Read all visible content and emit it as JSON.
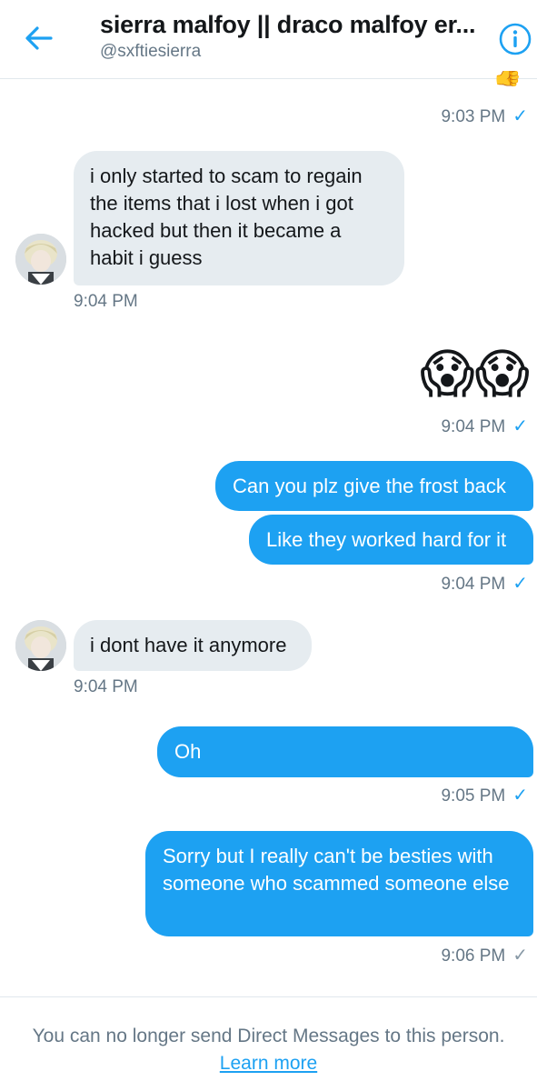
{
  "header": {
    "title": "sierra malfoy || draco malfoy er...",
    "handle": "@sxftiesierra"
  },
  "messages": [
    {
      "id": "m0",
      "from": "them",
      "text": "👍",
      "time": "9:03 PM",
      "status": "read"
    },
    {
      "id": "m1",
      "from": "other",
      "text": "i only started to scam to regain the items that i lost when i got hacked but then it became a habit i guess",
      "time": "9:04 PM"
    },
    {
      "id": "m2",
      "from": "me",
      "text": "😱😱",
      "time": "9:04 PM",
      "status": "read"
    },
    {
      "id": "m3",
      "from": "me",
      "text": "Can you plz give the frost back"
    },
    {
      "id": "m4",
      "from": "me",
      "text": "Like they worked hard for it",
      "time": "9:04 PM",
      "status": "read"
    },
    {
      "id": "m5",
      "from": "other",
      "text": "i dont have it anymore",
      "time": "9:04 PM"
    },
    {
      "id": "m6",
      "from": "me",
      "text": "Oh",
      "time": "9:05 PM",
      "status": "read"
    },
    {
      "id": "m7",
      "from": "me",
      "text": "Sorry but I really can't be besties with someone who scammed someone else",
      "time": "9:06 PM",
      "status": "sent"
    }
  ],
  "footer": {
    "notice": "You can no longer send Direct Messages to this person.",
    "link": "Learn more"
  },
  "colors": {
    "accent": "#1da1f2",
    "received_bubble": "#e6ecf0",
    "muted_text": "#657786"
  }
}
